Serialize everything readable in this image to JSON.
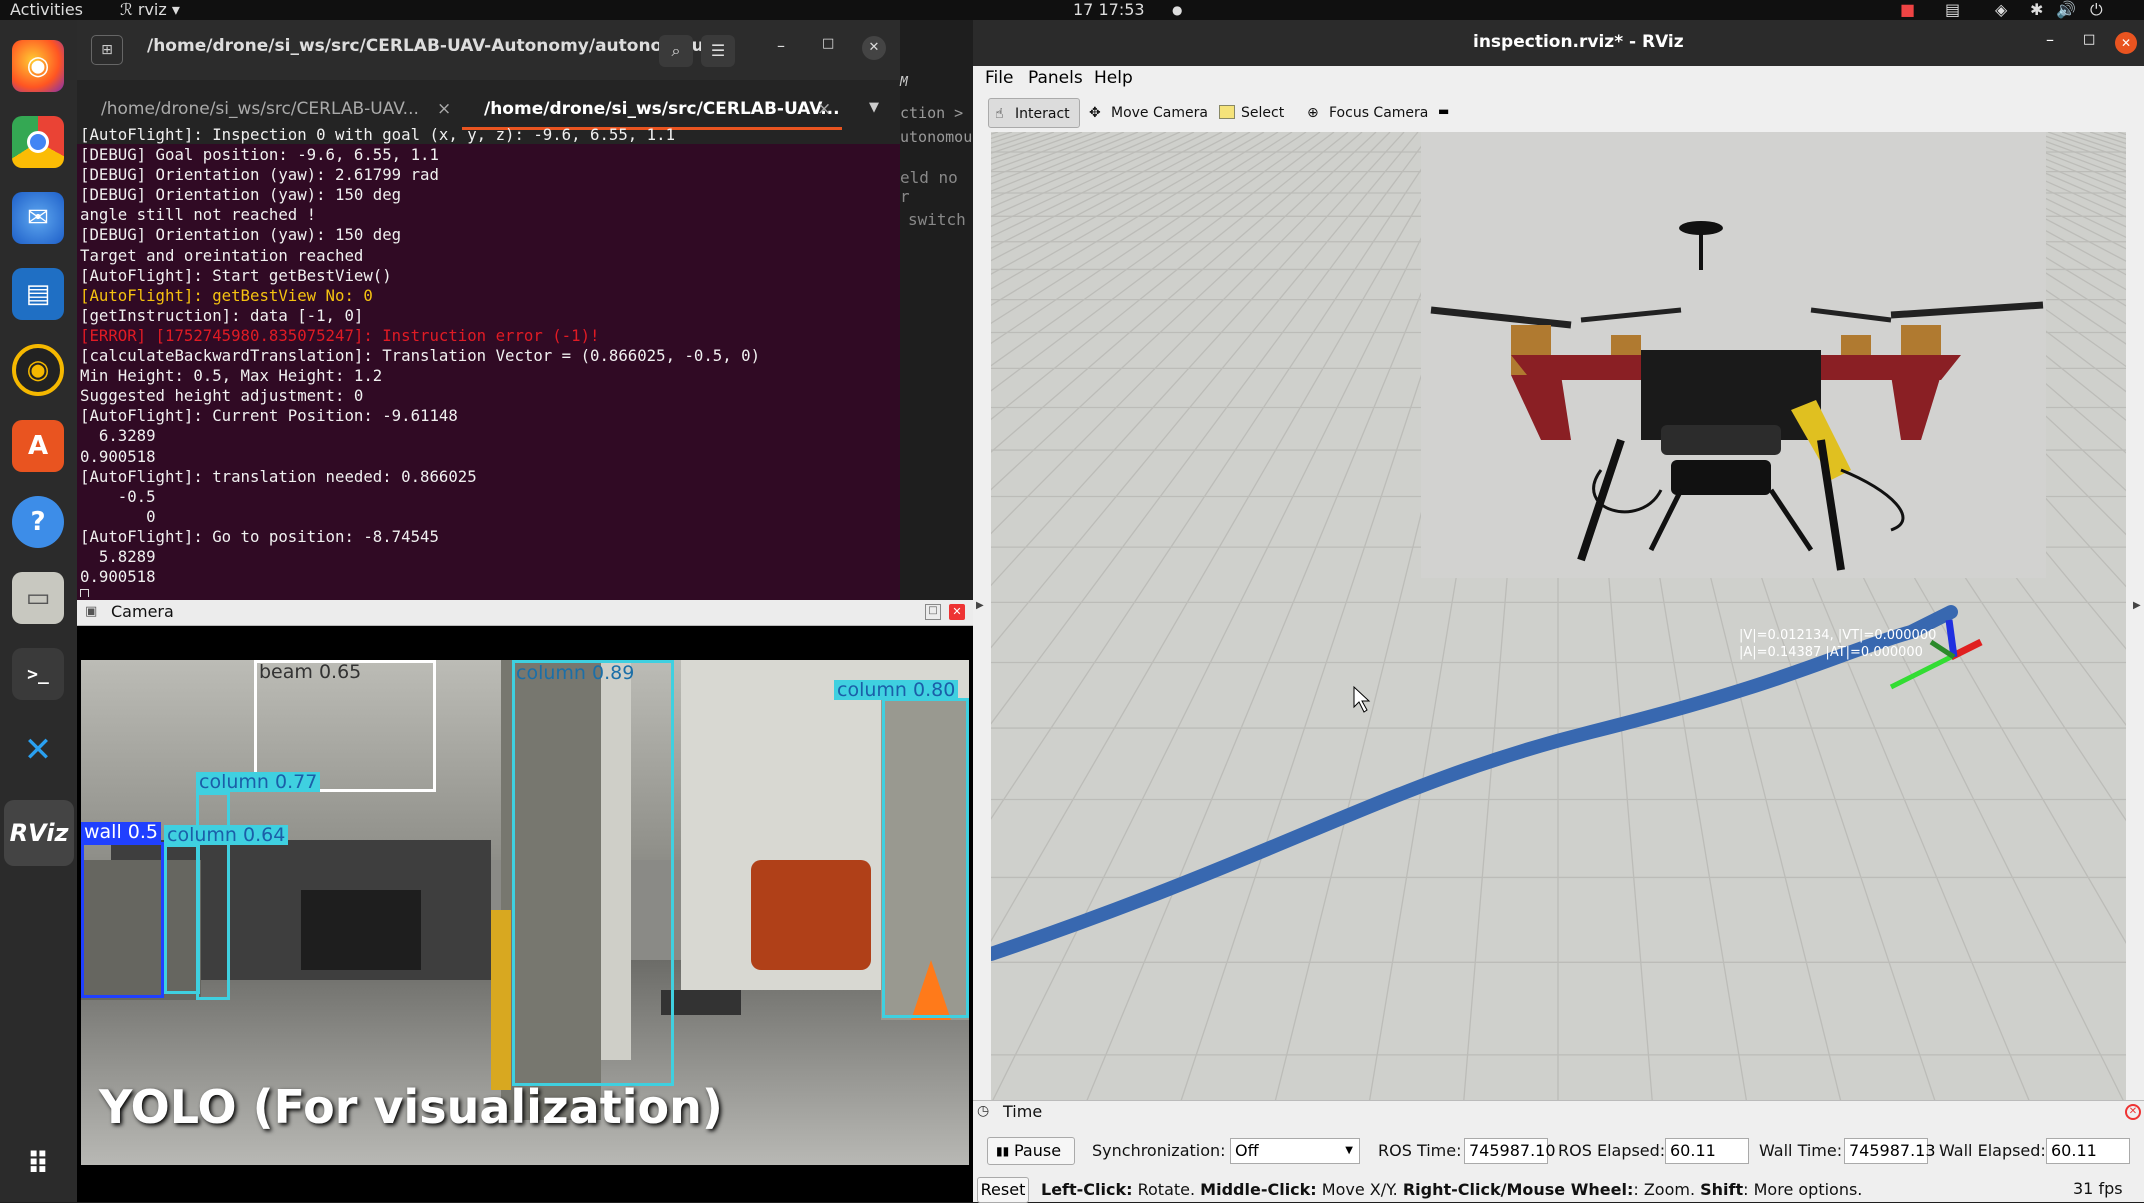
{
  "topbar": {
    "activities": "Activities",
    "app": "rviz",
    "date": "17",
    "time": "17:53"
  },
  "terminal": {
    "title": "/home/drone/si_ws/src/CERLAB-UAV-Autonomy/autonomou...",
    "tabs": [
      "/home/drone/si_ws/src/CERLAB-UAV...",
      "/home/drone/si_ws/src/CERLAB-UAV..."
    ],
    "lines": [
      "[AutoFlight]: Inspection 0 with goal (x, y, z): -9.6, 6.55, 1.1",
      "[DEBUG] Goal position: -9.6, 6.55, 1.1",
      "[DEBUG] Orientation (yaw): 2.61799 rad",
      "[DEBUG] Orientation (yaw): 150 deg",
      "angle still not reached !",
      "[DEBUG] Orientation (yaw): 150 deg",
      "Target and oreintation reached",
      "[AutoFlight]: Start getBestView()",
      "[AutoFlight]: getBestView No: 0",
      "[getInstruction]: data [-1, 0]",
      "[ERROR] [1752745980.835075247]: Instruction error (-1)!",
      "[calculateBackwardTranslation]: Translation Vector = (0.866025, -0.5, 0)",
      "Min Height: 0.5, Max Height: 1.2",
      "Suggested height adjustment: 0",
      "[AutoFlight]: Current Position: -9.61148",
      "  6.3289",
      "0.900518",
      "[AutoFlight]: translation needed: 0.866025",
      "    -0.5",
      "       0",
      "[AutoFlight]: Go to position: -8.74545",
      "  5.8289",
      "0.900518"
    ]
  },
  "editor_strip": {
    "lines": [
      "M",
      "ction >",
      "utonomou",
      "eld no r",
      "switch"
    ]
  },
  "camera": {
    "title": "Camera",
    "caption": "YOLO (For visualization)",
    "detections": [
      {
        "label": "beam 0.65",
        "color": "#ffffff"
      },
      {
        "label": "column 0.89",
        "color": "#3fd0e0"
      },
      {
        "label": "column 0.80",
        "color": "#3fd0e0"
      },
      {
        "label": "column 0.77",
        "color": "#3fd0e0"
      },
      {
        "label": "wall 0.5",
        "color": "#2040ff"
      },
      {
        "label": "column 0.64",
        "color": "#3fd0e0"
      }
    ]
  },
  "rviz": {
    "title": "inspection.rviz* - RViz",
    "menu": [
      "File",
      "Panels",
      "Help"
    ],
    "tools": [
      "Interact",
      "Move Camera",
      "Select",
      "Focus Camera"
    ],
    "overlay": [
      "|V|=0.012134, |VT|=0.000000",
      "|A|=0.14387 |AT|=0.000000"
    ],
    "time_panel": {
      "title": "Time",
      "pause": "Pause",
      "sync_label": "Synchronization:",
      "sync_value": "Off",
      "ros_time_label": "ROS Time:",
      "ros_time": "745987.10",
      "ros_elapsed_label": "ROS Elapsed:",
      "ros_elapsed": "60.11",
      "wall_time_label": "Wall Time:",
      "wall_time": "745987.13",
      "wall_elapsed_label": "Wall Elapsed:",
      "wall_elapsed": "60.11"
    },
    "status": {
      "reset": "Reset",
      "help_left": "Left-Click:",
      "help_left_t": " Rotate. ",
      "help_mid": "Middle-Click:",
      "help_mid_t": " Move X/Y. ",
      "help_right": "Right-Click/Mouse Wheel:",
      "help_right_t": ": Zoom. ",
      "help_shift": "Shift",
      "help_shift_t": ": More options.",
      "fps": "31 fps"
    }
  }
}
